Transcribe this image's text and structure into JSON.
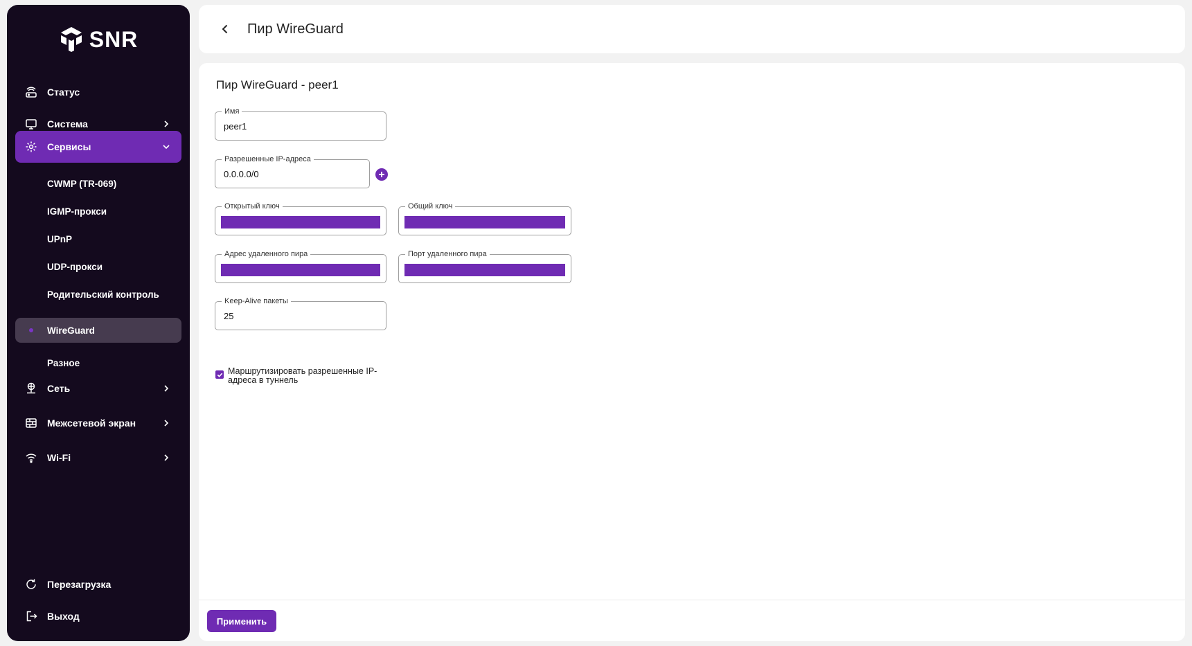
{
  "brand": {
    "name": "SNR"
  },
  "colors": {
    "accent": "#6f2bb3",
    "sidebar_bg": "#140a1e",
    "active_sub_bg": "#463b4f"
  },
  "sidebar": {
    "items": [
      {
        "label": "Статус",
        "icon": "router-icon"
      },
      {
        "label": "Система",
        "icon": "monitor-icon"
      },
      {
        "label": "Сервисы",
        "icon": "gear-icon",
        "expanded": true
      },
      {
        "label": "Сеть",
        "icon": "network-icon"
      },
      {
        "label": "Межсетевой экран",
        "icon": "firewall-icon"
      },
      {
        "label": "Wi-Fi",
        "icon": "wifi-icon"
      }
    ],
    "subitems": [
      {
        "label": "CWMP (TR-069)"
      },
      {
        "label": "IGMP-прокси"
      },
      {
        "label": "UPnP"
      },
      {
        "label": "UDP-прокси"
      },
      {
        "label": "Родительский контроль"
      },
      {
        "label": "WireGuard",
        "active": true
      },
      {
        "label": "Разное"
      }
    ],
    "bottom": [
      {
        "label": "Перезагрузка",
        "icon": "reload-icon"
      },
      {
        "label": "Выход",
        "icon": "logout-icon"
      }
    ]
  },
  "header": {
    "title": "Пир WireGuard"
  },
  "form": {
    "title": "Пир WireGuard - peer1",
    "name": {
      "label": "Имя",
      "value": "peer1"
    },
    "allowed_ips": {
      "label": "Разрешенные IP-адреса",
      "value": "0.0.0.0/0"
    },
    "public_key": {
      "label": "Открытый ключ"
    },
    "shared_key": {
      "label": "Общий ключ"
    },
    "remote_addr": {
      "label": "Адрес удаленного пира"
    },
    "remote_port": {
      "label": "Порт удаленного пира"
    },
    "keepalive": {
      "label": "Keep-Alive пакеты",
      "value": "25"
    },
    "route_checkbox": {
      "label": "Маршрутизировать разрешенные IP-адреса в туннель",
      "checked": true
    }
  },
  "footer": {
    "apply_label": "Применить"
  }
}
